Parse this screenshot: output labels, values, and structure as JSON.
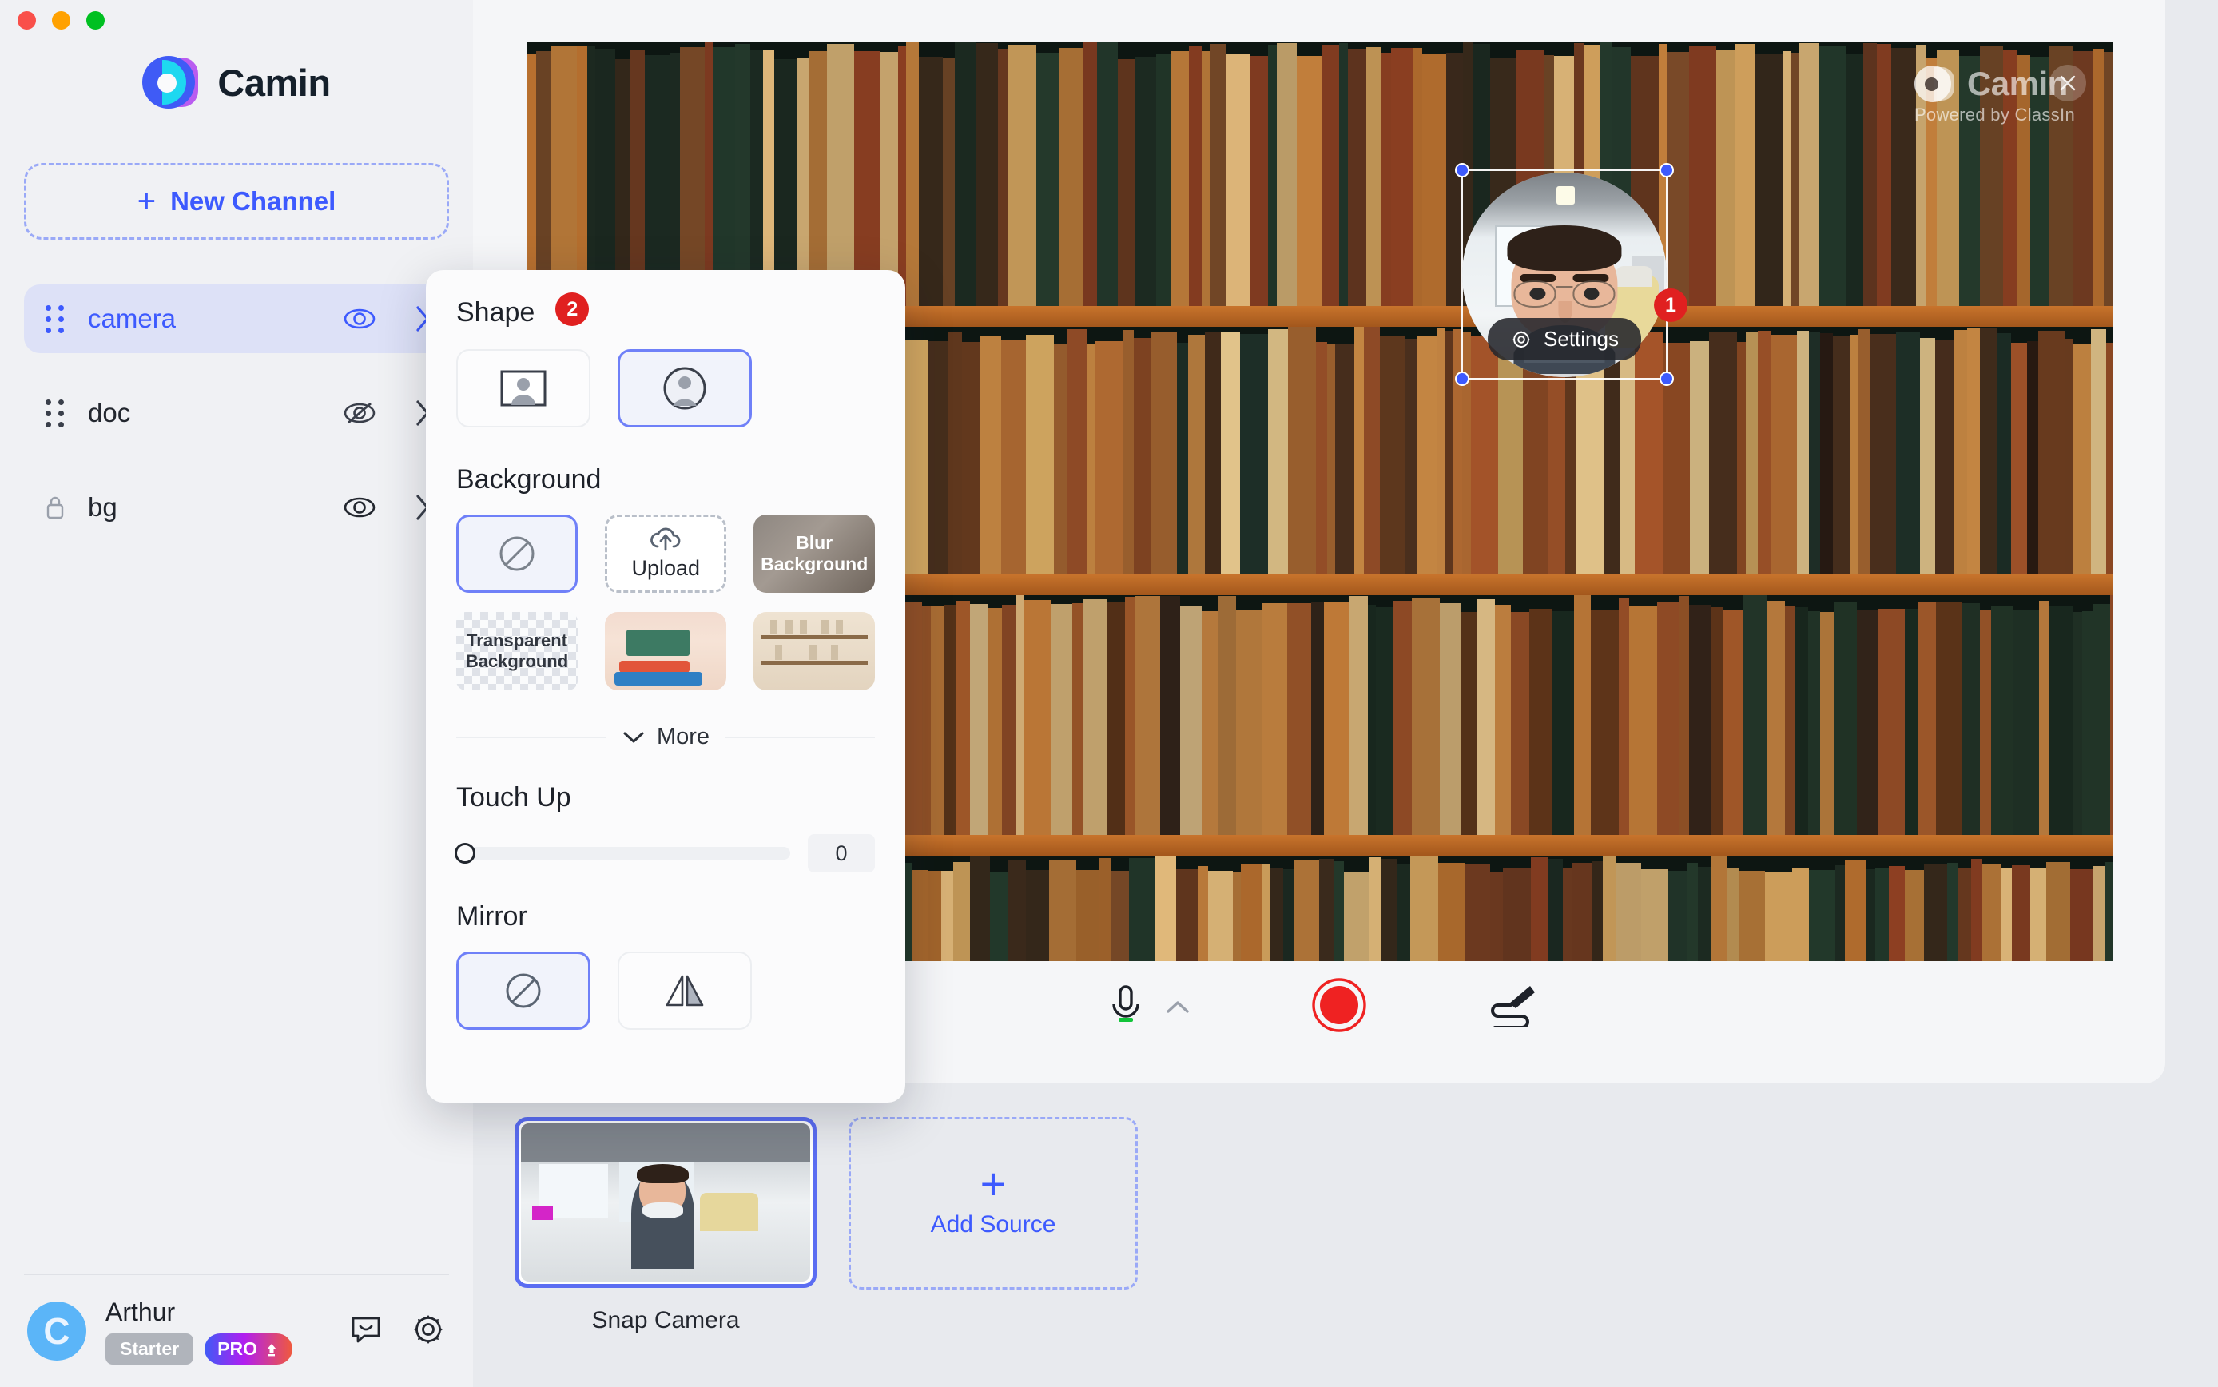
{
  "window": {
    "traffic_lights": [
      "close",
      "minimize",
      "zoom"
    ],
    "colors": {
      "red": "#f9504a",
      "amber": "#ffa100",
      "green": "#00c021",
      "accent": "#3d5afe",
      "badge_red": "#e02020"
    }
  },
  "sidebar": {
    "brand": "Camin",
    "new_channel_label": "New Channel",
    "new_channel_plus": "+",
    "channels": [
      {
        "name": "camera",
        "visible": true,
        "locked": false,
        "active": true
      },
      {
        "name": "doc",
        "visible": false,
        "locked": false,
        "active": false
      },
      {
        "name": "bg",
        "visible": true,
        "locked": true,
        "active": false
      }
    ],
    "user": {
      "initial": "C",
      "name": "Arthur",
      "plan_badge": "Starter",
      "upgrade_badge": "PRO"
    }
  },
  "video": {
    "watermark_name": "Camin",
    "watermark_sub": "Powered by ClassIn",
    "overlay": {
      "settings_label": "Settings",
      "badge": "1"
    }
  },
  "toolbar": {
    "mic_label": "Microphone",
    "mic_chevron": "chevron-up",
    "record_label": "Record",
    "pen_label": "Annotate"
  },
  "sources": {
    "items": [
      {
        "label": "Snap Camera",
        "selected": true
      }
    ],
    "add_source": {
      "plus": "+",
      "label": "Add Source"
    }
  },
  "panel": {
    "shape": {
      "title": "Shape",
      "badge": "2",
      "options": [
        {
          "name": "rectangle",
          "selected": false
        },
        {
          "name": "circle",
          "selected": true
        }
      ]
    },
    "background": {
      "title": "Background",
      "options": [
        {
          "name": "none",
          "label": "",
          "selected": true
        },
        {
          "name": "upload",
          "label": "Upload",
          "selected": false
        },
        {
          "name": "blur",
          "label": "Blur Background",
          "selected": false
        },
        {
          "name": "transparent",
          "label": "Transparent Background",
          "selected": false
        },
        {
          "name": "classroom",
          "label": "",
          "selected": false
        },
        {
          "name": "library",
          "label": "",
          "selected": false
        }
      ]
    },
    "more_label": "More",
    "touch_up": {
      "title": "Touch Up",
      "value": "0",
      "min": 0,
      "max": 100
    },
    "mirror": {
      "title": "Mirror",
      "options": [
        {
          "name": "off",
          "selected": true
        },
        {
          "name": "flip-horizontal",
          "selected": false
        }
      ]
    }
  }
}
